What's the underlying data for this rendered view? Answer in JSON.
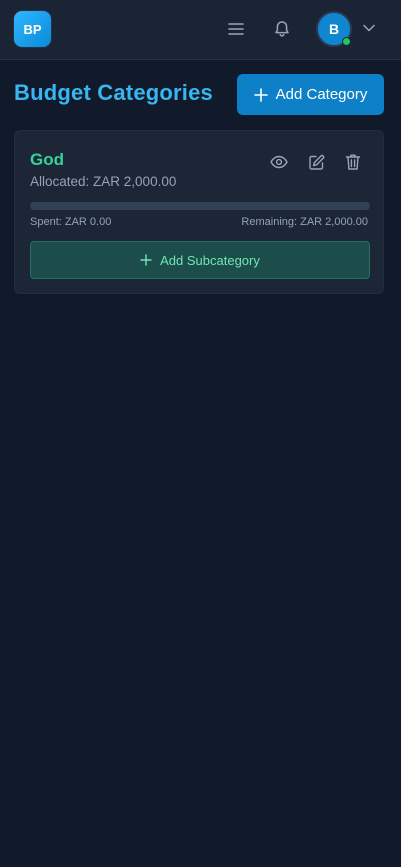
{
  "header": {
    "logo_text": "BP",
    "avatar_initial": "B",
    "icons": [
      "menu-icon",
      "bell-icon",
      "chevron-down-icon"
    ],
    "status_color": "#22c55e"
  },
  "page": {
    "title": "Budget Categories",
    "add_category_label": "Add Category"
  },
  "categories": [
    {
      "name": "God",
      "allocated_text": "Allocated: ZAR 2,000.00",
      "spent_text": "Spent: ZAR 0.00",
      "remaining_text": "Remaining: ZAR 2,000.00",
      "spent_fraction": 0,
      "add_subcategory_label": "Add Subcategory",
      "actions": [
        "eye-icon",
        "edit-icon",
        "trash-icon"
      ]
    }
  ],
  "colors": {
    "accent": "#0e80c8",
    "title": "#38b6f0",
    "category": "#34d399",
    "background": "#111a2b"
  }
}
